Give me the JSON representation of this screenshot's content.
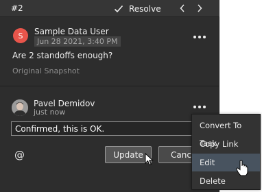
{
  "header": {
    "number": "#2",
    "resolve_label": "Resolve"
  },
  "comment1": {
    "avatar_initial": "S",
    "avatar_color": "#e8554b",
    "author": "Sample Data User",
    "date": "Jun 28 2021, 3:40 PM",
    "text": "Are 2 standoffs enough?",
    "snapshot_link": "Original Snapshot"
  },
  "comment2": {
    "author": "Pavel Demidov",
    "time": "just now",
    "edit_value": "Confirmed, this is OK.",
    "at_symbol": "@",
    "update_label": "Update",
    "cancel_label": "Cancel"
  },
  "context_menu": {
    "items": [
      {
        "label": "Convert To Task"
      },
      {
        "label": "Copy Link"
      },
      {
        "label": "Edit",
        "state": "hovered"
      },
      {
        "label": "Delete"
      }
    ]
  }
}
